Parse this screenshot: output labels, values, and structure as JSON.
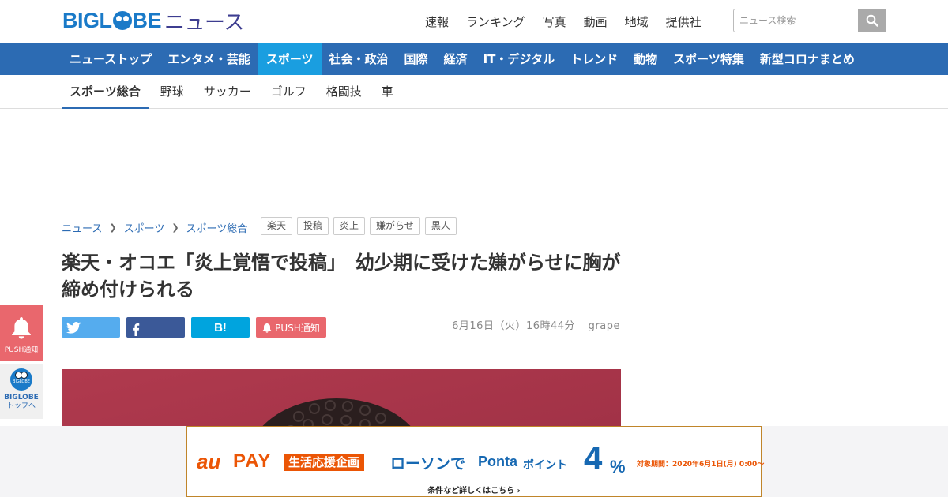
{
  "brand": {
    "logo_left": "BIGL",
    "logo_right": "BE",
    "logo_news": "ニュース",
    "color": "#1a7ac8"
  },
  "header": {
    "links": [
      "速報",
      "ランキング",
      "写真",
      "動画",
      "地域",
      "提供社"
    ],
    "search_placeholder": "ニュース検索"
  },
  "mainnav": {
    "items": [
      "ニューストップ",
      "エンタメ・芸能",
      "スポーツ",
      "社会・政治",
      "国際",
      "経済",
      "IT・デジタル",
      "トレンド",
      "動物",
      "スポーツ特集",
      "新型コロナまとめ"
    ],
    "active_index": 2,
    "bg_color": "#2c6bb3",
    "active_color": "#1a9ee0"
  },
  "subnav": {
    "items": [
      "スポーツ総合",
      "野球",
      "サッカー",
      "ゴルフ",
      "格闘技",
      "車"
    ],
    "active_index": 0
  },
  "breadcrumb": [
    "ニュース",
    "スポーツ",
    "スポーツ総合"
  ],
  "tags": [
    "楽天",
    "投稿",
    "炎上",
    "嫌がらせ",
    "黒人"
  ],
  "article": {
    "title": "楽天・オコエ「炎上覚悟で投稿」　幼少期に受けた嫌がらせに胸が締め付けられる",
    "date": "6月16日（火）16時44分",
    "source": "grape"
  },
  "share": {
    "hatena_label": "B!",
    "push_label": "PUSH通知"
  },
  "floating": {
    "push_label": "PUSH通知",
    "biglobe_ball": "BIGLOBE",
    "top_label_1": "BIGLOBE",
    "top_label_2": "トップへ"
  },
  "ad": {
    "au": "au",
    "pay": "PAY",
    "plan": "生活応援企画",
    "lawson": "ローソンで",
    "ponta": "Ponta",
    "point": "ポイント",
    "percent": "4",
    "percent_sign": "%",
    "period": "対象期間：2020年6月1日(月) 0:00〜",
    "detail": "条件など詳しくはこちら ›"
  }
}
